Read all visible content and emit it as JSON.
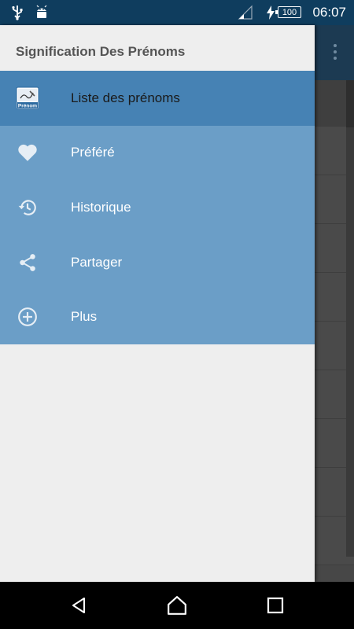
{
  "status_bar": {
    "time": "06:07",
    "battery": "100",
    "icons": [
      "usb-icon",
      "android-icon",
      "signal-icon",
      "charging-icon"
    ]
  },
  "drawer": {
    "title": "Signification Des Prénoms",
    "logo_text": "Prénom",
    "items": [
      {
        "label": "Liste des prénoms",
        "icon": "book-icon",
        "active": true
      },
      {
        "label": "Préféré",
        "icon": "heart-icon",
        "active": false
      },
      {
        "label": "Historique",
        "icon": "history-icon",
        "active": false
      },
      {
        "label": "Partager",
        "icon": "share-icon",
        "active": false
      },
      {
        "label": "Plus",
        "icon": "plus-circle-icon",
        "active": false
      }
    ]
  },
  "colors": {
    "status_bar": "#0f3d5e",
    "menu_active": "#4682b4",
    "menu_bg": "#6b9ec7",
    "drawer_bg": "#eeeeee"
  }
}
